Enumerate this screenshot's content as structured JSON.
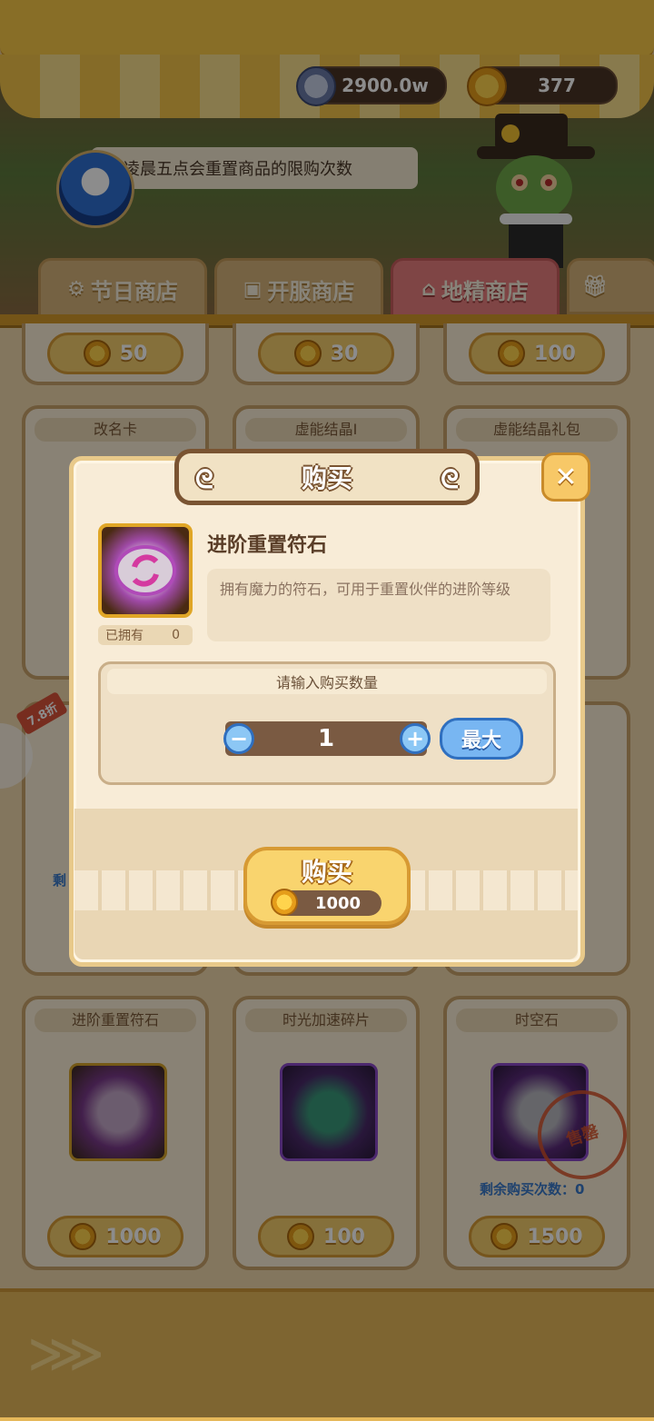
{
  "currency": {
    "silver": "2900.0w",
    "gold": "377"
  },
  "notice": "凌晨五点会重置商品的限购次数",
  "tabs": [
    {
      "label": "节日商店",
      "icon": "gear-icon"
    },
    {
      "label": "开服商店",
      "icon": "ticket-icon"
    },
    {
      "label": "地精商店",
      "icon": "shop-icon"
    },
    {
      "label": "",
      "icon": "gift-icon"
    }
  ],
  "grid": {
    "row0_prices": [
      "50",
      "30",
      "100"
    ],
    "row1_titles": [
      "改名卡",
      "虚能结晶Ⅰ",
      "虚能结晶礼包"
    ],
    "discount": "7.8折",
    "row2_partial_remain": "剩",
    "row3": [
      {
        "title": "进阶重置符石",
        "price": "1000",
        "icon": "rune-icon"
      },
      {
        "title": "时光加速碎片",
        "price": "100",
        "icon": "crystal-icon"
      },
      {
        "title": "时空石",
        "price": "1500",
        "icon": "space-stone-icon",
        "remain": "剩余购买次数：0",
        "stamp": "售罄"
      }
    ]
  },
  "dialog": {
    "title": "购买",
    "item_name": "进阶重置符石",
    "owned_label": "已拥有",
    "owned_count": "0",
    "description": "拥有魔力的符石，可用于重置伙伴的进阶等级",
    "qty_label": "请输入购买数量",
    "quantity": "1",
    "minus": "−",
    "plus": "+",
    "max_label": "最大",
    "buy_label": "购买",
    "buy_price": "1000",
    "close": "✕"
  }
}
